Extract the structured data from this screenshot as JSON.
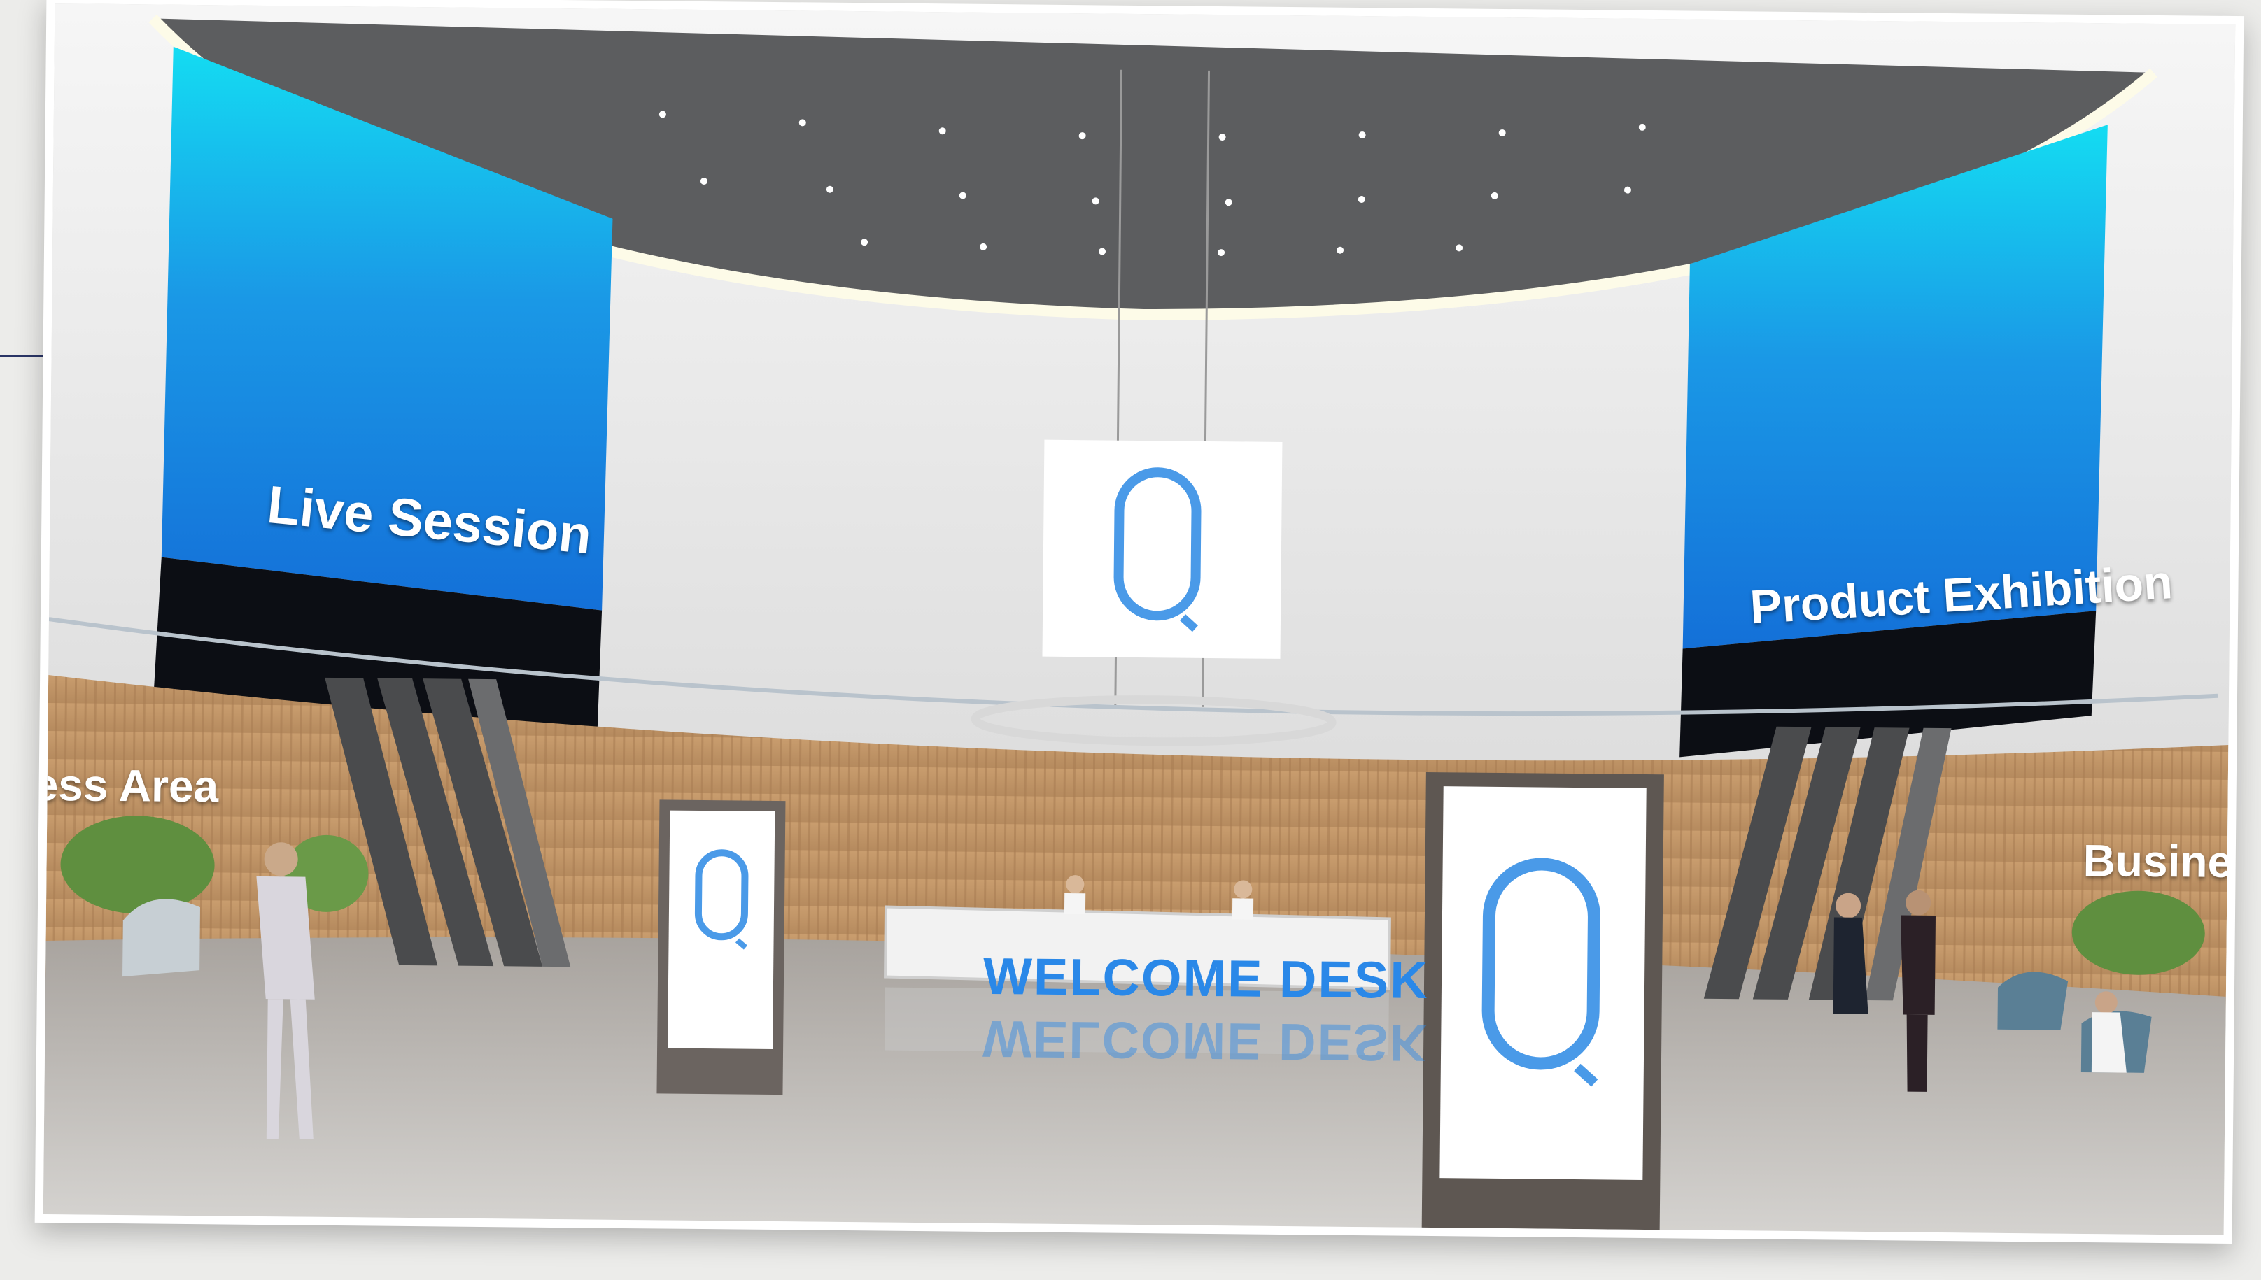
{
  "scene": {
    "signs": {
      "live_session": "Live Session",
      "product_exhibition": "Product Exhibition",
      "business_area_left": "ess Area",
      "business_area_right": "Business"
    },
    "desk": {
      "label": "WELCOME DESK"
    },
    "logo": {
      "glyph": "Q",
      "color": "#4a9ae8"
    },
    "colors": {
      "screen_blue": "#1c8fe8",
      "screen_cyan": "#14d8f0",
      "wood": "#c89a6a",
      "ceiling": "#5c5d5f"
    }
  }
}
